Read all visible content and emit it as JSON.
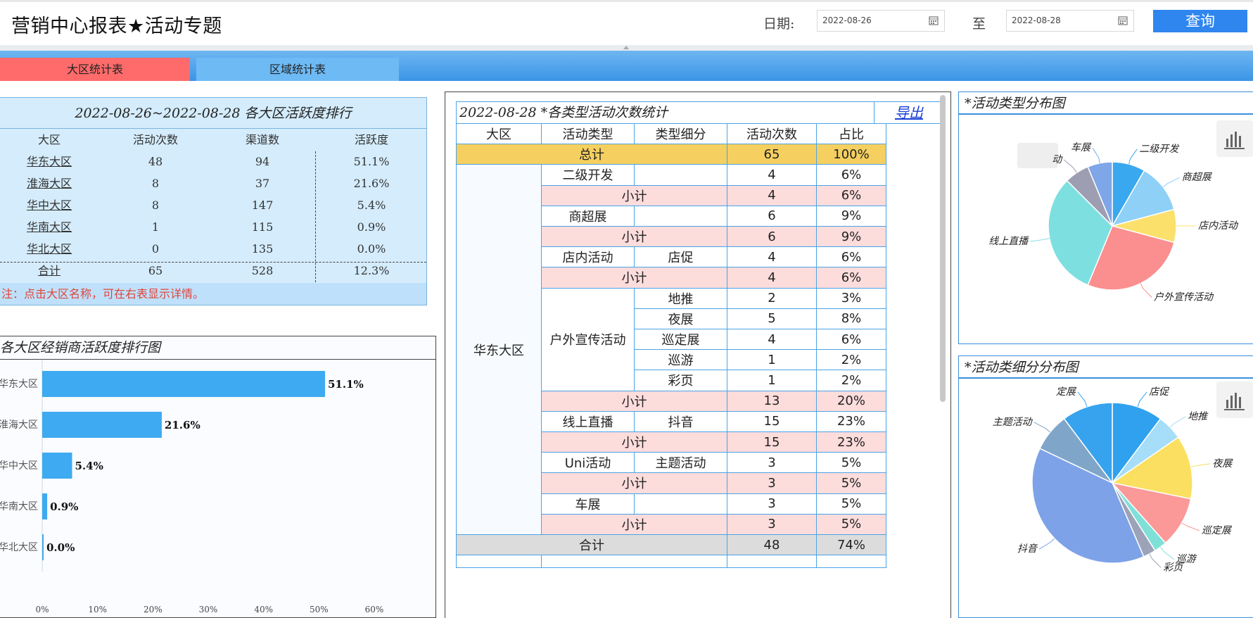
{
  "header": {
    "title": "营销中心报表★活动专题",
    "date_label": "日期:",
    "start_date": "2022-08-26",
    "to_label": "至",
    "end_date": "2022-08-28",
    "query_label": "查询"
  },
  "tabs": [
    {
      "label": "大区统计表",
      "active": true
    },
    {
      "label": "区域统计表",
      "active": false
    }
  ],
  "rank_table": {
    "title": "2022-08-26~2022-08-28 各大区活跃度排行",
    "headers": [
      "大区",
      "活动次数",
      "渠道数",
      "活跃度"
    ],
    "rows": [
      {
        "region": "华东大区",
        "count": "48",
        "channels": "94",
        "activity": "51.1%"
      },
      {
        "region": "淮海大区",
        "count": "8",
        "channels": "37",
        "activity": "21.6%"
      },
      {
        "region": "华中大区",
        "count": "8",
        "channels": "147",
        "activity": "5.4%"
      },
      {
        "region": "华南大区",
        "count": "1",
        "channels": "115",
        "activity": "0.9%"
      },
      {
        "region": "华北大区",
        "count": "0",
        "channels": "135",
        "activity": "0.0%"
      }
    ],
    "total": {
      "region": "合计",
      "count": "65",
      "channels": "528",
      "activity": "12.3%"
    },
    "note": "注：点击大区名称，可在右表显示详情。"
  },
  "bar_panel": {
    "title": "各大区经销商活跃度排行图"
  },
  "stats_table": {
    "title": "2022-08-28 *各类型活动次数统计",
    "export_label": "导出",
    "headers": [
      "大区",
      "活动类型",
      "类型细分",
      "活动次数",
      "占比"
    ],
    "grand_total": {
      "label": "总计",
      "count": "65",
      "ratio": "100%"
    },
    "region": "华东大区",
    "subtotal_label": "小计",
    "groups": [
      {
        "type": "二级开发",
        "items": [
          {
            "sub": "",
            "count": "4",
            "ratio": "6%"
          }
        ],
        "subtotal": {
          "count": "4",
          "ratio": "6%"
        }
      },
      {
        "type": "商超展",
        "items": [
          {
            "sub": "",
            "count": "6",
            "ratio": "9%"
          }
        ],
        "subtotal": {
          "count": "6",
          "ratio": "9%"
        }
      },
      {
        "type": "店内活动",
        "items": [
          {
            "sub": "店促",
            "count": "4",
            "ratio": "6%"
          }
        ],
        "subtotal": {
          "count": "4",
          "ratio": "6%"
        }
      },
      {
        "type": "户外宣传活动",
        "items": [
          {
            "sub": "地推",
            "count": "2",
            "ratio": "3%"
          },
          {
            "sub": "夜展",
            "count": "5",
            "ratio": "8%"
          },
          {
            "sub": "巡定展",
            "count": "4",
            "ratio": "6%"
          },
          {
            "sub": "巡游",
            "count": "1",
            "ratio": "2%"
          },
          {
            "sub": "彩页",
            "count": "1",
            "ratio": "2%"
          }
        ],
        "subtotal": {
          "count": "13",
          "ratio": "20%"
        }
      },
      {
        "type": "线上直播",
        "items": [
          {
            "sub": "抖音",
            "count": "15",
            "ratio": "23%"
          }
        ],
        "subtotal": {
          "count": "15",
          "ratio": "23%"
        }
      },
      {
        "type": "Uni活动",
        "items": [
          {
            "sub": "主题活动",
            "count": "3",
            "ratio": "5%"
          }
        ],
        "subtotal": {
          "count": "3",
          "ratio": "5%"
        }
      },
      {
        "type": "车展",
        "items": [
          {
            "sub": "",
            "count": "3",
            "ratio": "5%"
          }
        ],
        "subtotal": {
          "count": "3",
          "ratio": "5%"
        }
      }
    ],
    "region_total": {
      "label": "合计",
      "count": "48",
      "ratio": "74%"
    }
  },
  "pie_panels": [
    {
      "title": "*活动类型分布图"
    },
    {
      "title": "*活动类细分分布图"
    }
  ],
  "colors": {
    "accent": "#2f86ef",
    "tab_active": "#ff6b6b",
    "tab_inactive": "#6dbaf5",
    "total_row": "#f5d060",
    "subtotal_row": "#fddcdc",
    "sum_row": "#dcdcdc",
    "bar": "#3eaaf1",
    "note_red": "#e0453a"
  },
  "icons": [
    "calendar-icon",
    "calendar-icon",
    "grip-icon",
    "chart-icon",
    "chart-icon"
  ],
  "chart_data": [
    {
      "type": "bar",
      "orientation": "horizontal",
      "title": "各大区经销商活跃度排行图",
      "categories": [
        "华东大区",
        "淮海大区",
        "华中大区",
        "华南大区",
        "华北大区"
      ],
      "values": [
        51.1,
        21.6,
        5.4,
        0.9,
        0.0
      ],
      "value_labels": [
        "51.1%",
        "21.6%",
        "5.4%",
        "0.9%",
        "0.0%"
      ],
      "xlim": [
        0,
        60
      ],
      "x_ticks": [
        "0%",
        "10%",
        "20%",
        "30%",
        "40%",
        "50%",
        "60%"
      ],
      "grid": false,
      "color": "#3eaaf1"
    },
    {
      "type": "pie",
      "title": "*活动类型分布图",
      "labels": [
        "二级开发",
        "商超展",
        "店内活动",
        "户外宣传活动",
        "线上直播",
        "Uni活动",
        "车展"
      ],
      "visible_labels": [
        "二级开发",
        "商超展",
        "店内活动",
        "户外宣传活动",
        "线上直播",
        "动",
        "车展"
      ],
      "values": [
        4,
        6,
        4,
        13,
        15,
        3,
        3
      ],
      "colors": [
        "#3aa8ee",
        "#8fd0f7",
        "#fbe06b",
        "#fb8e8e",
        "#7edfe0",
        "#9e9eb3",
        "#7ea6e8"
      ]
    },
    {
      "type": "pie",
      "title": "*活动类细分分布图",
      "labels": [
        "店促",
        "地推",
        "夜展",
        "巡定展",
        "巡游",
        "彩页",
        "抖音",
        "主题活动",
        "定展"
      ],
      "values": [
        4,
        2,
        5,
        4,
        1,
        1,
        15,
        3,
        4
      ],
      "colors": [
        "#2fa1ee",
        "#a6ddf8",
        "#fbdf60",
        "#fb9898",
        "#7fe0d8",
        "#9ca3b8",
        "#7ea2e8",
        "#7fa6c9",
        "#37a3ee"
      ]
    }
  ]
}
